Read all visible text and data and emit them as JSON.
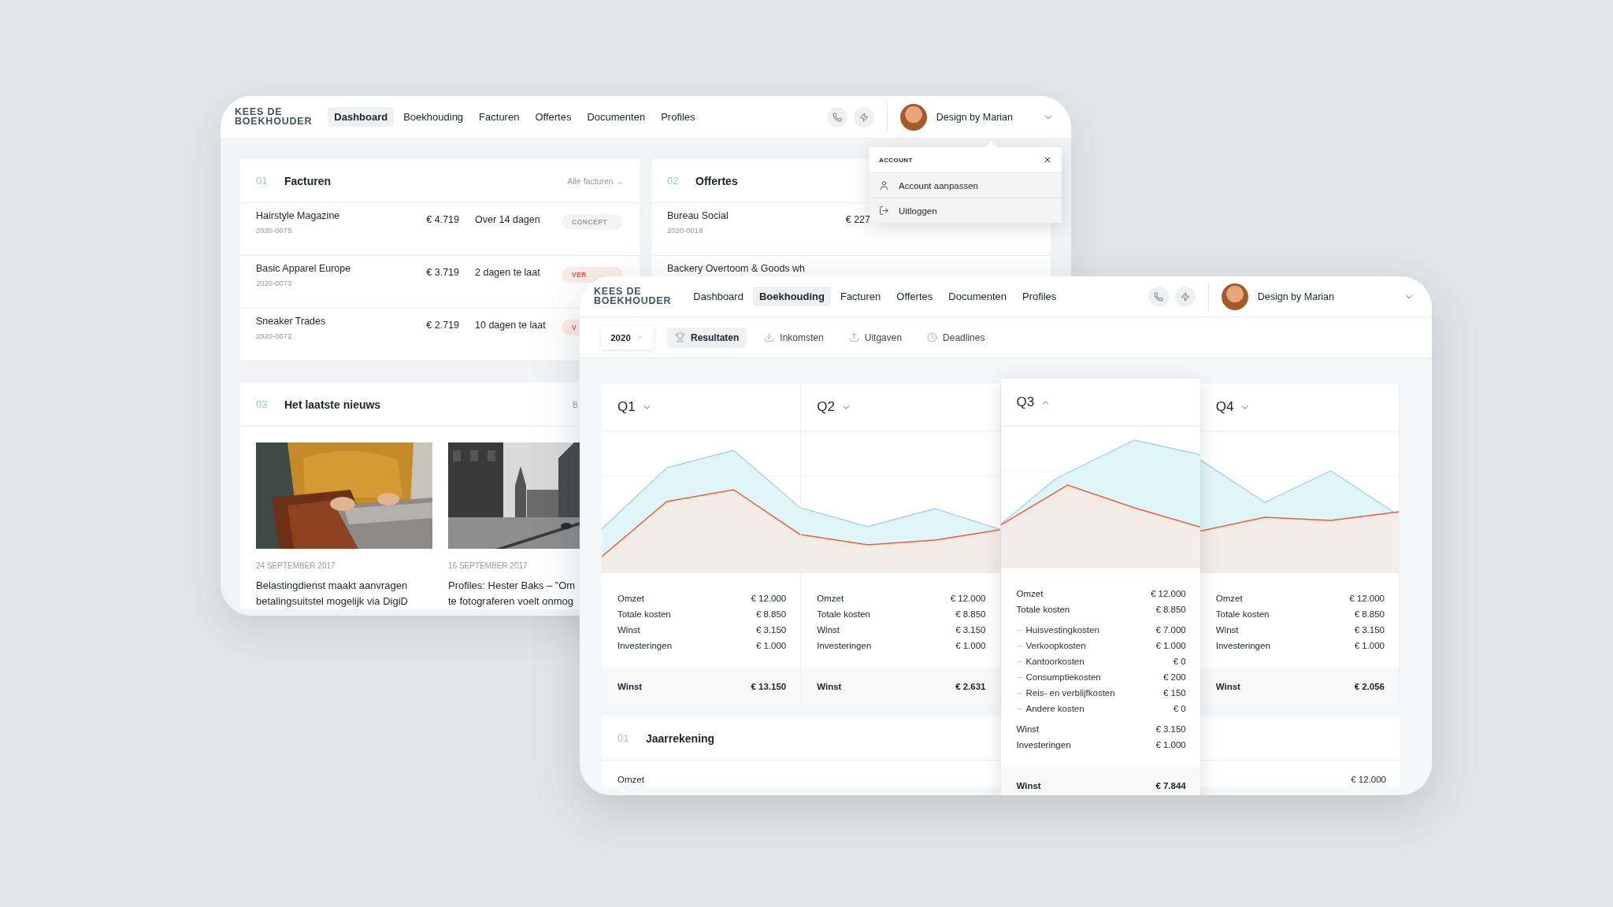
{
  "back_window": {
    "nav": {
      "logo": "KEES DE BOEKHOUDER",
      "items": [
        {
          "label": "Dashboard",
          "selected": true
        },
        {
          "label": "Boekhouding",
          "selected": false
        },
        {
          "label": "Facturen",
          "selected": false
        },
        {
          "label": "Offertes",
          "selected": false
        },
        {
          "label": "Documenten",
          "selected": false
        },
        {
          "label": "Profiles",
          "selected": false
        }
      ],
      "user": "Design by Marian"
    },
    "account_menu": {
      "title": "ACCOUNT",
      "items": [
        {
          "label": "Account aanpassen",
          "kind": "profile"
        },
        {
          "label": "Uitloggen",
          "kind": "logout"
        }
      ]
    },
    "invoices": {
      "number": "01",
      "title": "Facturen",
      "link": "Alle facturen →",
      "rows": [
        {
          "name": "Hairstyle Magazine",
          "number": "2020-0075",
          "amount": "€ 4.719",
          "due": "Over 14 dagen",
          "status": "CONCEPT",
          "color": "#9a9a9a"
        },
        {
          "name": "Basic Apparel Europe",
          "number": "2020-0073",
          "amount": "€ 3.719",
          "due": "2 dagen te laat",
          "status": "VER",
          "color": "#e8553a"
        },
        {
          "name": "Sneaker Trades",
          "number": "2020-0072",
          "amount": "€ 2.719",
          "due": "10 dagen te laat",
          "status": "V",
          "color": "#e8553a"
        }
      ]
    },
    "quotes": {
      "number": "02",
      "title": "Offertes",
      "rows": [
        {
          "name": "Bureau Social",
          "number": "2020-0018",
          "amount": "€ 227"
        },
        {
          "name": "Backery Overtoom & Goods wh"
        }
      ]
    },
    "news": {
      "number": "03",
      "title": "Het laatste nieuws",
      "link": "B",
      "articles": [
        {
          "date": "24 SEPTEMBER 2017",
          "headline_lines": [
            "Belastingdienst maakt aanvragen",
            "betalingsuitstel mogelijk via DigiD"
          ]
        },
        {
          "date": "16 SEPTEMBER 2017",
          "headline_lines": [
            "Profiles: Hester Baks – ”Om",
            "te fotograferen voelt onmog"
          ]
        }
      ]
    }
  },
  "front_window": {
    "nav": {
      "logo": "KEES DE BOEKHOUDER",
      "items": [
        {
          "label": "Dashboard",
          "selected": false
        },
        {
          "label": "Boekhouding",
          "selected": true
        },
        {
          "label": "Facturen",
          "selected": false
        },
        {
          "label": "Offertes",
          "selected": false
        },
        {
          "label": "Documenten",
          "selected": false
        },
        {
          "label": "Profiles",
          "selected": false
        }
      ],
      "user": "Design by Marian"
    },
    "year": "2020",
    "tabs": [
      {
        "label": "Resultaten",
        "kind": "trophy",
        "selected": true
      },
      {
        "label": "Inkomsten",
        "kind": "download",
        "selected": false
      },
      {
        "label": "Uitgaven",
        "kind": "upload",
        "selected": false
      },
      {
        "label": "Deadlines",
        "kind": "clock",
        "selected": false
      }
    ],
    "quarters": [
      {
        "label": "Q1",
        "expanded": false,
        "rows": [
          {
            "label": "Omzet",
            "value": "€ 12.000",
            "kind": "main"
          },
          {
            "label": "Totale kosten",
            "value": "€ 8.850",
            "kind": "main"
          },
          {
            "label": "Winst",
            "value": "€ 3.150",
            "kind": "main"
          },
          {
            "label": "Investeringen",
            "value": "€ 1.000",
            "kind": "main"
          }
        ],
        "total": {
          "label": "Winst",
          "value": "€ 13.150"
        }
      },
      {
        "label": "Q2",
        "expanded": false,
        "rows": [
          {
            "label": "Omzet",
            "value": "€ 12.000",
            "kind": "main"
          },
          {
            "label": "Totale kosten",
            "value": "€ 8.850",
            "kind": "main"
          },
          {
            "label": "Winst",
            "value": "€ 3.150",
            "kind": "main"
          },
          {
            "label": "Investeringen",
            "value": "€ 1.000",
            "kind": "main"
          }
        ],
        "total": {
          "label": "Winst",
          "value": "€ 2.631"
        }
      },
      {
        "label": "Q3",
        "expanded": true,
        "rows": [
          {
            "label": "Omzet",
            "value": "€ 12.000",
            "kind": "main"
          },
          {
            "label": "Totale kosten",
            "value": "€ 8.850",
            "kind": "main"
          },
          {
            "label": "Huisvestingkosten",
            "value": "€ 7.000",
            "kind": "sub"
          },
          {
            "label": "Verkoopkosten",
            "value": "€ 1.000",
            "kind": "sub"
          },
          {
            "label": "Kantoorkosten",
            "value": "€ 0",
            "kind": "sub"
          },
          {
            "label": "Consumptiekosten",
            "value": "€ 200",
            "kind": "sub"
          },
          {
            "label": "Reis- en verblijfkosten",
            "value": "€ 150",
            "kind": "sub"
          },
          {
            "label": "Andere kosten",
            "value": "€ 0",
            "kind": "sub"
          },
          {
            "label": "Winst",
            "value": "€ 3.150",
            "kind": "main"
          },
          {
            "label": "Investeringen",
            "value": "€ 1.000",
            "kind": "main"
          }
        ],
        "total": {
          "label": "Winst",
          "value": "€ 7.844"
        }
      },
      {
        "label": "Q4",
        "expanded": false,
        "rows": [
          {
            "label": "Omzet",
            "value": "€ 12.000",
            "kind": "main"
          },
          {
            "label": "Totale kosten",
            "value": "€ 8.850",
            "kind": "main"
          },
          {
            "label": "Winst",
            "value": "€ 3.150",
            "kind": "main"
          },
          {
            "label": "Investeringen",
            "value": "€ 1.000",
            "kind": "main"
          }
        ],
        "total": {
          "label": "Winst",
          "value": "€ 2.056"
        }
      }
    ],
    "annual": {
      "number": "01",
      "title": "Jaarrekening",
      "rows": [
        {
          "label": "Omzet",
          "value": "€ 12.000"
        }
      ]
    }
  }
}
